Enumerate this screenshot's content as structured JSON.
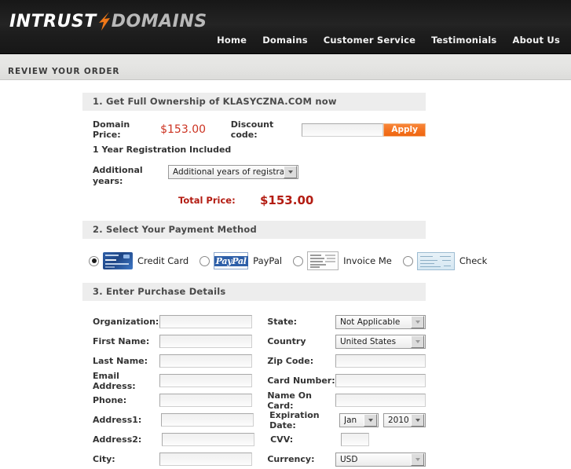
{
  "header": {
    "logo": {
      "part1": "INTRUST",
      "part2": "DOMAINS",
      "mark": "orange-lightning-mark",
      "accent_color": "#f07818"
    },
    "nav": [
      {
        "label": "Home",
        "name": "nav-item-home"
      },
      {
        "label": "Domains",
        "name": "nav-item-domains"
      },
      {
        "label": "Customer Service",
        "name": "nav-item-customer-service"
      },
      {
        "label": "Testimonials",
        "name": "nav-item-testimonials"
      },
      {
        "label": "About Us",
        "name": "nav-item-about-us"
      }
    ]
  },
  "page": {
    "title": "REVIEW YOUR ORDER"
  },
  "section1": {
    "header": "1. Get Full Ownership of KLASYCZNA.COM now",
    "domain_price_label": "Domain Price:",
    "domain_price_value": "$153.00",
    "discount_label": "Discount code:",
    "discount_value": "",
    "discount_placeholder": "",
    "apply_label": "Apply",
    "registration_note": "1 Year Registration Included",
    "additional_years_label": "Additional years:",
    "additional_years_selected": "Additional years of registration",
    "total_label": "Total Price:",
    "total_value": "$153.00",
    "price_color": "#cc3322"
  },
  "section2": {
    "header": "2. Select Your Payment Method",
    "selected": "credit-card",
    "options": [
      {
        "label": "Credit Card",
        "icon": "credit-card-icon",
        "checked": true
      },
      {
        "label": "PayPal",
        "icon": "paypal-icon",
        "checked": false
      },
      {
        "label": "Invoice Me",
        "icon": "invoice-icon",
        "checked": false
      },
      {
        "label": "Check",
        "icon": "check-icon",
        "checked": false
      }
    ],
    "paypal_wordmark": "PayPal"
  },
  "section3": {
    "header": "3. Enter Purchase Details",
    "left_fields": [
      {
        "label": "Organization:",
        "name": "organization",
        "value": ""
      },
      {
        "label": "First Name:",
        "name": "first-name",
        "value": ""
      },
      {
        "label": "Last Name:",
        "name": "last-name",
        "value": ""
      },
      {
        "label": "Email Address:",
        "name": "email-address",
        "value": ""
      },
      {
        "label": "Phone:",
        "name": "phone",
        "value": ""
      },
      {
        "label": "Address1:",
        "name": "address1",
        "value": ""
      },
      {
        "label": "Address2:",
        "name": "address2",
        "value": ""
      },
      {
        "label": "City:",
        "name": "city",
        "value": ""
      }
    ],
    "right_fields": [
      {
        "label": "State:",
        "name": "state",
        "type": "select",
        "value": "Not Applicable"
      },
      {
        "label": "Country",
        "name": "country",
        "type": "select",
        "value": "United States"
      },
      {
        "label": "Zip Code:",
        "name": "zip-code",
        "type": "text",
        "value": ""
      },
      {
        "label": "Card Number:",
        "name": "card-number",
        "type": "text",
        "value": ""
      },
      {
        "label": "Name On Card:",
        "name": "name-on-card",
        "type": "text",
        "value": ""
      },
      {
        "label": "Expiration Date:",
        "name": "expiration-date",
        "type": "date",
        "month": "Jan",
        "year": "2010"
      },
      {
        "label": "CVV:",
        "name": "cvv",
        "type": "text-small",
        "value": ""
      },
      {
        "label": "Currency:",
        "name": "currency",
        "type": "select",
        "value": "USD"
      }
    ]
  }
}
